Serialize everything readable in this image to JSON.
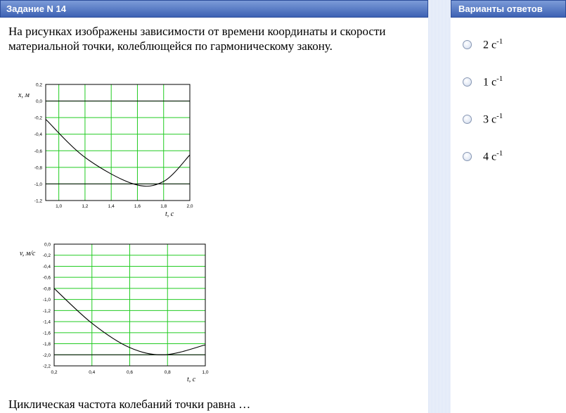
{
  "header": {
    "task_title": "Задание N 14",
    "answers_title": "Варианты ответов"
  },
  "question": {
    "text": "На рисунках изображены зависимости от времени координаты и скорости материальной точки, колеблющейся по гармоническому закону.",
    "tail": "Циклическая частота колебаний точки равна …"
  },
  "answers": [
    {
      "value": "2 с",
      "exponent": "-1"
    },
    {
      "value": "1 с",
      "exponent": "-1"
    },
    {
      "value": "3 с",
      "exponent": "-1"
    },
    {
      "value": "4 с",
      "exponent": "-1"
    }
  ],
  "colors": {
    "grid": "#22cc22",
    "curve": "#000000",
    "header": "#3d62b4"
  },
  "chart_data": [
    {
      "type": "line",
      "ylabel": "x, м",
      "xlabel": "t, с",
      "xlim": [
        0.9,
        2.0
      ],
      "ylim": [
        -1.2,
        0.2
      ],
      "x_ticks": [
        "1,0",
        "1,2",
        "1,4",
        "1,6",
        "1,8",
        "2,0"
      ],
      "y_ticks": [
        "0,2",
        "0,0",
        "-0,2",
        "-0,4",
        "-0,6",
        "-0,8",
        "-1,0",
        "-1,2"
      ],
      "grid": true,
      "series": [
        {
          "x": [
            0.9,
            1.2,
            1.57,
            1.8,
            2.0
          ],
          "y": [
            -0.22,
            -0.68,
            -1.0,
            -0.97,
            -0.65
          ]
        }
      ]
    },
    {
      "type": "line",
      "ylabel": "v, м/с",
      "xlabel": "t, с",
      "xlim": [
        0.2,
        1.0
      ],
      "ylim": [
        -2.2,
        0.0
      ],
      "x_ticks": [
        "0,2",
        "0,4",
        "0,6",
        "0,8",
        "1,0"
      ],
      "y_ticks": [
        "0,0",
        "-0,2",
        "-0,4",
        "-0,6",
        "-0,8",
        "-1,0",
        "-1,2",
        "-1,4",
        "-1,6",
        "-1,8",
        "-2,0",
        "-2,2"
      ],
      "grid": true,
      "series": [
        {
          "x": [
            0.2,
            0.4,
            0.6,
            0.785,
            1.0
          ],
          "y": [
            -0.8,
            -1.43,
            -1.87,
            -2.0,
            -1.82
          ]
        }
      ]
    }
  ]
}
